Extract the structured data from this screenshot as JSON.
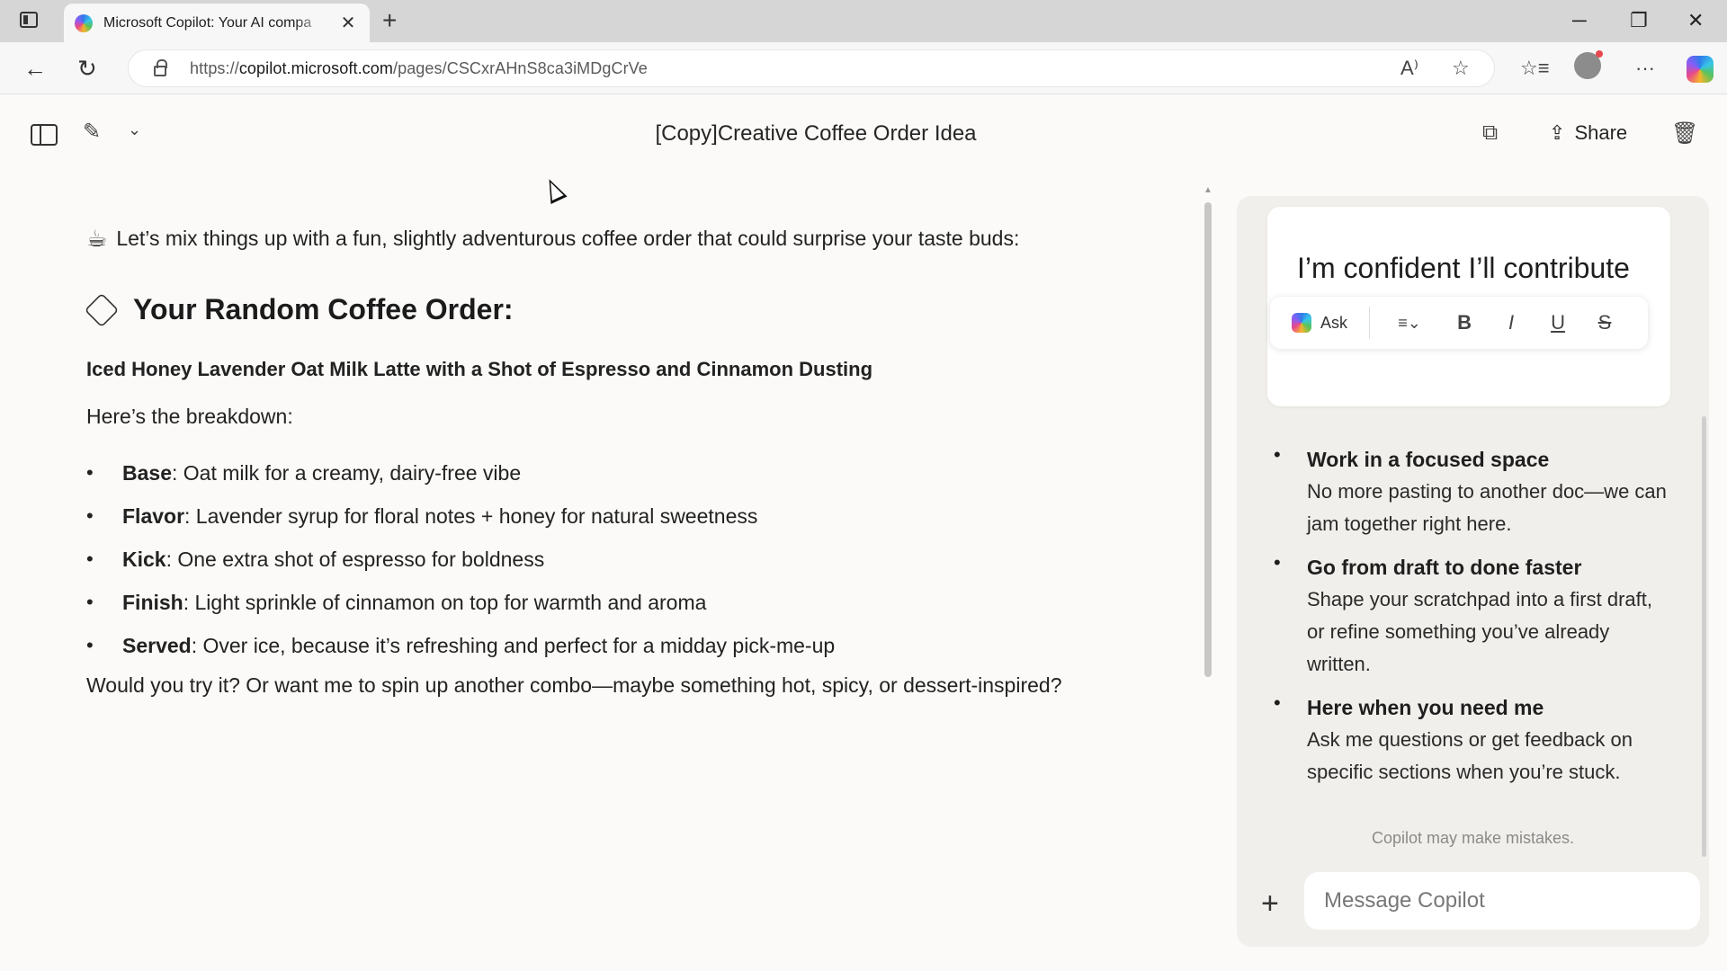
{
  "browser": {
    "tab_title": "Microsoft Copilot: Your AI compa",
    "url_prefix": "https://",
    "url_domain": "copilot.microsoft.com",
    "url_path": "/pages/CSCxrAHnS8ca3iMDgCrVe"
  },
  "header": {
    "title": "[Copy]Creative Coffee Order Idea",
    "share_label": "Share"
  },
  "content": {
    "intro": "Let’s mix things up with a fun, slightly adventurous coffee order that could surprise your taste buds:",
    "heading": "Your Random Coffee Order:",
    "order_name": "Iced Honey Lavender Oat Milk Latte with a Shot of Espresso and Cinnamon Dusting",
    "breakdown_label": "Here’s the breakdown:",
    "items": [
      {
        "label": "Base",
        "text": ": Oat milk for a creamy, dairy-free vibe"
      },
      {
        "label": "Flavor",
        "text": ": Lavender syrup for floral notes + honey for natural sweetness"
      },
      {
        "label": "Kick",
        "text": ": One extra shot of espresso for boldness"
      },
      {
        "label": "Finish",
        "text": ": Light sprinkle of cinnamon on top for warmth and aroma"
      },
      {
        "label": "Served",
        "text": ": Over ice, because it’s refreshing and perfect for a midday pick-me-up"
      }
    ],
    "closing": "Would you try it? Or want me to spin up another combo—maybe something hot, spicy, or dessert-inspired?"
  },
  "panel": {
    "card_text": "I’m confident I’ll contribute",
    "toolbar": {
      "ask_label": "Ask",
      "bold": "B",
      "italic": "I",
      "underline": "U",
      "strike": "S"
    },
    "features": [
      {
        "title": "Work in a focused space",
        "desc": "No more pasting to another doc—we can jam together right here."
      },
      {
        "title": "Go from draft to done faster",
        "desc": "Shape your scratchpad into a first draft, or refine something you’ve already written."
      },
      {
        "title": "Here when you need me",
        "desc": "Ask me questions or get feedback on specific sections when you’re stuck."
      }
    ],
    "disclaimer": "Copilot may make mistakes.",
    "message_placeholder": "Message Copilot"
  }
}
